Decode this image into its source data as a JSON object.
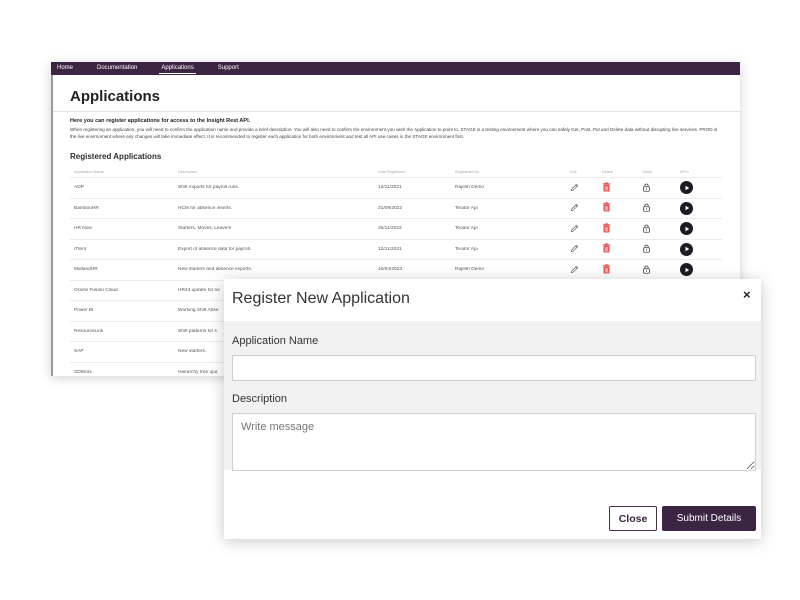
{
  "nav": [
    "Home",
    "Documentation",
    "Applications",
    "Support"
  ],
  "nav_active_index": 2,
  "page": {
    "title": "Applications",
    "intro_heading": "Here you can register applications for access to the Insight Rest API.",
    "intro_body": "When registering an application, you will need to confirm the application name and provide a brief description. You will also need to confirm the environment you wish the Application to point to. STAGE is a testing environment where you can safely Get, Post, Put and Delete data without disrupting live services. PROD is the live environment where any changes will take immediate effect. It is recommended to register each application for both environment and test all API use cases in the STAGE environment first.",
    "registered_title": "Registered Applications"
  },
  "table": {
    "headers": [
      "Application Name",
      "Description",
      "Date Registered",
      "Registered By",
      "Edit",
      "Delete",
      "Token",
      "API's"
    ],
    "rows": [
      {
        "name": "ADP",
        "description": "Shift exports for payroll runs.",
        "date": "12/11/2021",
        "by": "Rajesh Demo",
        "actions": true
      },
      {
        "name": "BambooHR",
        "description": "HCM for absence inserts.",
        "date": "21/09/2022",
        "by": "Teodor Api",
        "actions": true
      },
      {
        "name": "HR Now",
        "description": "Starters, Moves, Leavers",
        "date": "25/11/2022",
        "by": "Teodor Api",
        "actions": true
      },
      {
        "name": "iTrent",
        "description": "Export of absence data for payroll.",
        "date": "12/11/2021",
        "by": "Teodor Api",
        "actions": true
      },
      {
        "name": "MidlandHR",
        "description": "New starters and absence exports.",
        "date": "10/04/2023",
        "by": "Rajesh Demo",
        "actions": true
      },
      {
        "name": "Oracle Fusion Cloud",
        "description": "HR44 update for ne",
        "date": "",
        "by": "",
        "actions": false
      },
      {
        "name": "Power BI",
        "description": "Working Shift Abse",
        "date": "",
        "by": "",
        "actions": false
      },
      {
        "name": "ResourceLink",
        "description": "Shift patterns for s",
        "date": "",
        "by": "",
        "actions": false
      },
      {
        "name": "SAP",
        "description": "New starters.",
        "date": "",
        "by": "",
        "actions": false
      },
      {
        "name": "SDWorx",
        "description": "Hierarchy tree upd",
        "date": "",
        "by": "",
        "actions": false
      }
    ]
  },
  "modal": {
    "title": "Register New Application",
    "close_glyph": "×",
    "name_label": "Application Name",
    "name_value": "",
    "desc_label": "Description",
    "desc_placeholder": "Write message",
    "close_button": "Close",
    "submit_button": "Submit Details"
  },
  "colors": {
    "brand": "#3c2542",
    "delete_icon": "#e8534f",
    "play_icon": "#1e1a24"
  },
  "icons": {
    "edit": "pencil-icon",
    "delete": "trash-icon",
    "token": "lock-icon",
    "api": "play-icon"
  }
}
